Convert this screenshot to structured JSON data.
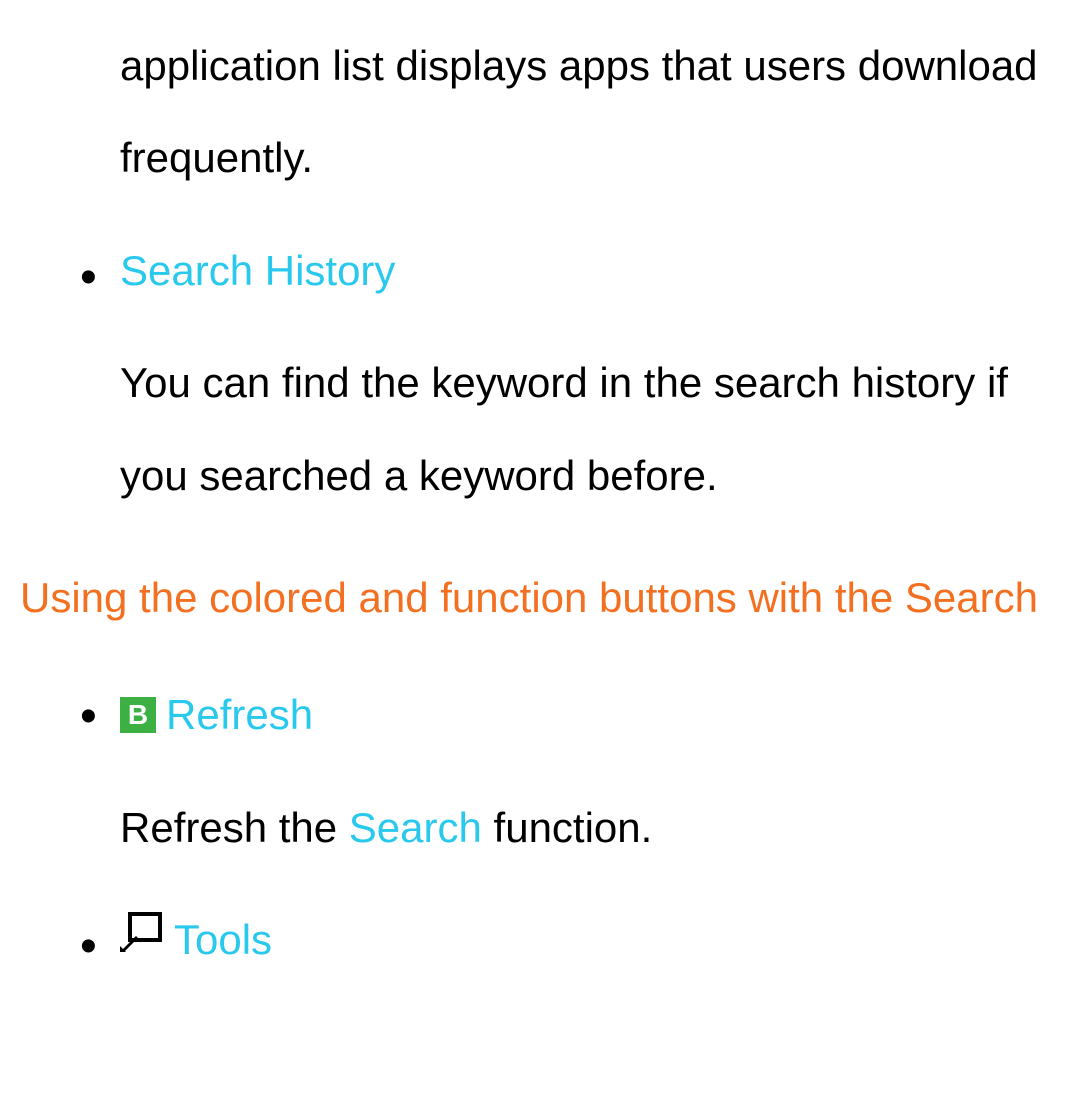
{
  "intro_text": "application list displays apps that users download frequently.",
  "items": [
    {
      "title": "Search History",
      "desc": "You can find the keyword in the search history if you searched a keyword before."
    }
  ],
  "section_heading": "Using the colored and function buttons with the Search",
  "buttons": [
    {
      "icon_letter": "B",
      "label": "Refresh",
      "desc_prefix": "Refresh the ",
      "desc_link": "Search",
      "desc_suffix": " function."
    },
    {
      "label": "Tools"
    }
  ]
}
